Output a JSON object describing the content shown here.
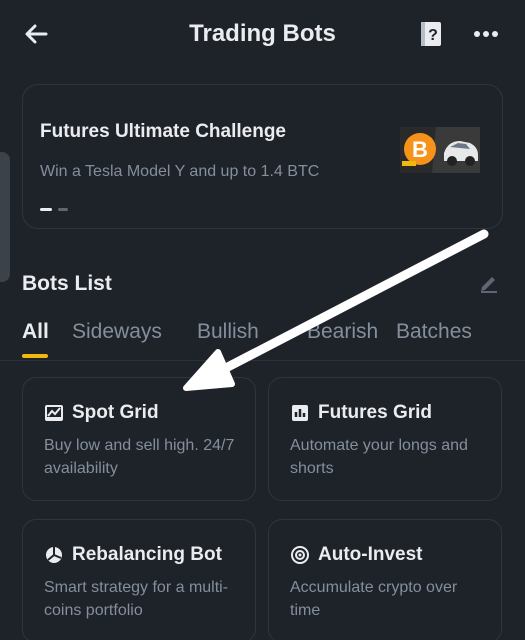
{
  "header": {
    "title": "Trading Bots",
    "back_icon": "arrow-left-icon",
    "help_icon": "help-book-icon",
    "more_icon": "more-dots-icon"
  },
  "banner": {
    "title": "Futures Ultimate Challenge",
    "subtitle": "Win a Tesla Model Y and up to 1.4 BTC",
    "image_icon": "bitcoin-tesla-promo-icon"
  },
  "bots_list": {
    "title": "Bots List",
    "edit_icon": "edit-pencil-icon"
  },
  "tabs": [
    {
      "label": "All",
      "active": true
    },
    {
      "label": "Sideways",
      "active": false
    },
    {
      "label": "Bullish",
      "active": false
    },
    {
      "label": "Bearish",
      "active": false
    },
    {
      "label": "Batches",
      "active": false
    }
  ],
  "cards": [
    {
      "title": "Spot Grid",
      "description": "Buy low and sell high. 24/7 availability",
      "icon": "spot-grid-icon"
    },
    {
      "title": "Futures Grid",
      "description": "Automate your longs and shorts",
      "icon": "futures-grid-icon"
    },
    {
      "title": "Rebalancing Bot",
      "description": "Smart strategy for a multi-coins portfolio",
      "icon": "rebalancing-icon"
    },
    {
      "title": "Auto-Invest",
      "description": "Accumulate crypto over time",
      "icon": "auto-invest-icon"
    }
  ],
  "colors": {
    "background": "#1e2329",
    "accent": "#f0b90b",
    "text_primary": "#eaecef",
    "text_secondary": "#848e9c"
  }
}
